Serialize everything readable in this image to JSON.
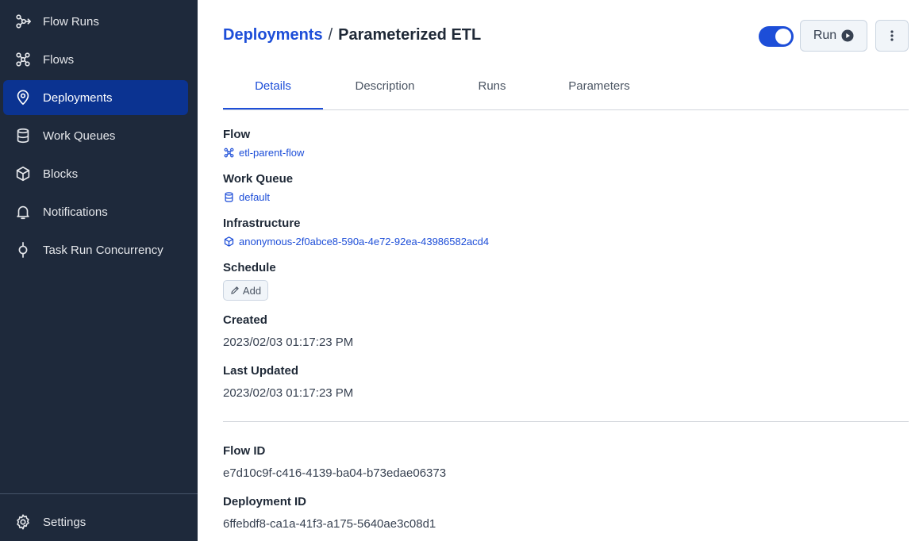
{
  "sidebar": {
    "items": [
      {
        "label": "Flow Runs",
        "icon": "flow-runs-icon"
      },
      {
        "label": "Flows",
        "icon": "flows-icon"
      },
      {
        "label": "Deployments",
        "icon": "deployments-icon",
        "active": true
      },
      {
        "label": "Work Queues",
        "icon": "work-queues-icon"
      },
      {
        "label": "Blocks",
        "icon": "blocks-icon"
      },
      {
        "label": "Notifications",
        "icon": "bell-icon"
      },
      {
        "label": "Task Run Concurrency",
        "icon": "concurrency-icon"
      }
    ],
    "settings_label": "Settings"
  },
  "header": {
    "breadcrumb_link": "Deployments",
    "separator": "/",
    "title": "Parameterized ETL",
    "toggle_on": true,
    "run_label": "Run"
  },
  "tabs": [
    "Details",
    "Description",
    "Runs",
    "Parameters"
  ],
  "details": {
    "flow_label": "Flow",
    "flow_value": "etl-parent-flow",
    "work_queue_label": "Work Queue",
    "work_queue_value": "default",
    "infrastructure_label": "Infrastructure",
    "infrastructure_value": "anonymous-2f0abce8-590a-4e72-92ea-43986582acd4",
    "schedule_label": "Schedule",
    "schedule_add_label": "Add",
    "created_label": "Created",
    "created_value": "2023/02/03 01:17:23 PM",
    "last_updated_label": "Last Updated",
    "last_updated_value": "2023/02/03 01:17:23 PM",
    "flow_id_label": "Flow ID",
    "flow_id_value": "e7d10c9f-c416-4139-ba04-b73edae06373",
    "deployment_id_label": "Deployment ID",
    "deployment_id_value": "6ffebdf8-ca1a-41f3-a175-5640ae3c08d1"
  },
  "colors": {
    "sidebar_bg": "#1e293b",
    "active_nav": "#0b3391",
    "accent": "#1d4ed8"
  }
}
